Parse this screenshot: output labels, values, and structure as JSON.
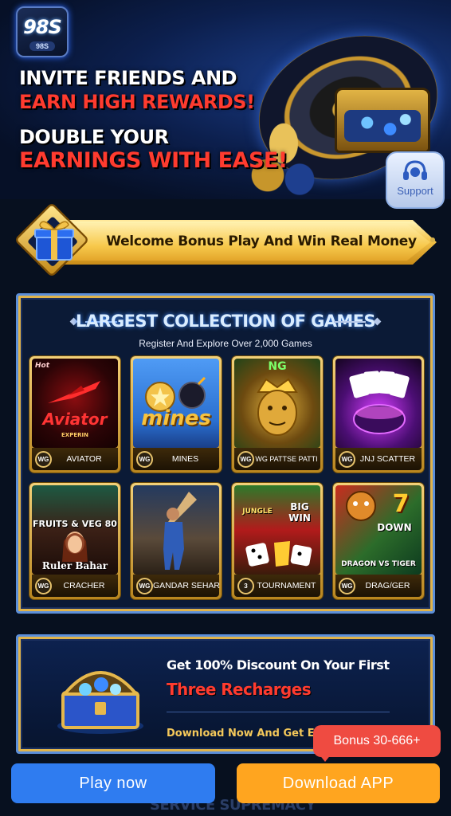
{
  "hero": {
    "logo_text": "98S",
    "logo_subtext": "98S",
    "line1": "INVITE FRIENDS AND",
    "line2": "EARN HIGH REWARDS!",
    "line3": "DOUBLE YOUR",
    "line4": "EARNINGS WITH EASE!"
  },
  "support": {
    "label": "Support",
    "icon": "headset-icon"
  },
  "welcome": {
    "text": "Welcome Bonus Play And Win Real Money",
    "icon": "gift-icon"
  },
  "games": {
    "title": "LARGEST COLLECTION OF GAMES",
    "subtitle": "Register And Explore Over 2,000 Games",
    "items": [
      {
        "name": "AVIATOR",
        "badge": "WG",
        "art_text": "Aviator",
        "art_tag": "Hot",
        "art_brand": "EXPERIN"
      },
      {
        "name": "MINES",
        "badge": "WG",
        "art_text": "mines",
        "art_tag": "",
        "art_brand": ""
      },
      {
        "name": "WG PATTSE PATTI",
        "badge": "WG",
        "art_text": "",
        "art_tag": "NG",
        "art_brand": ""
      },
      {
        "name": "JNJ SCATTER",
        "badge": "WG",
        "art_text": "",
        "art_tag": "",
        "art_brand": ""
      },
      {
        "name": "CRACHER",
        "badge": "WG",
        "art_text": "Ruler Bahar",
        "art_tag": "FRUITS & VEG 80",
        "art_brand": ""
      },
      {
        "name": "GANDAR SEHAR",
        "badge": "WG",
        "art_text": "",
        "art_tag": "",
        "art_brand": ""
      },
      {
        "name": "TOURNAMENT",
        "badge": "3",
        "art_text": "BIG WIN",
        "art_tag": "JUNGLE",
        "art_brand": ""
      },
      {
        "name": "DRAG/GER",
        "badge": "WG",
        "art_text": "DRAGON VS TIGER",
        "art_tag": "DOWN",
        "art_brand": ""
      }
    ]
  },
  "discount": {
    "line1": "Get 100% Discount On Your First",
    "line2": "Three Recharges",
    "line3": "Download Now And Get E"
  },
  "bottom": {
    "play_label": "Play now",
    "download_label": "Download APP",
    "bonus_label": "Bonus 30-666+",
    "peek_text": "SERVICE SUPREMACY"
  },
  "colors": {
    "accent_red": "#ff3b2f",
    "gold": "#e0b34a",
    "play_blue": "#2f7cf0",
    "download_orange": "#ffa51f",
    "bonus_red": "#ef4b41"
  }
}
